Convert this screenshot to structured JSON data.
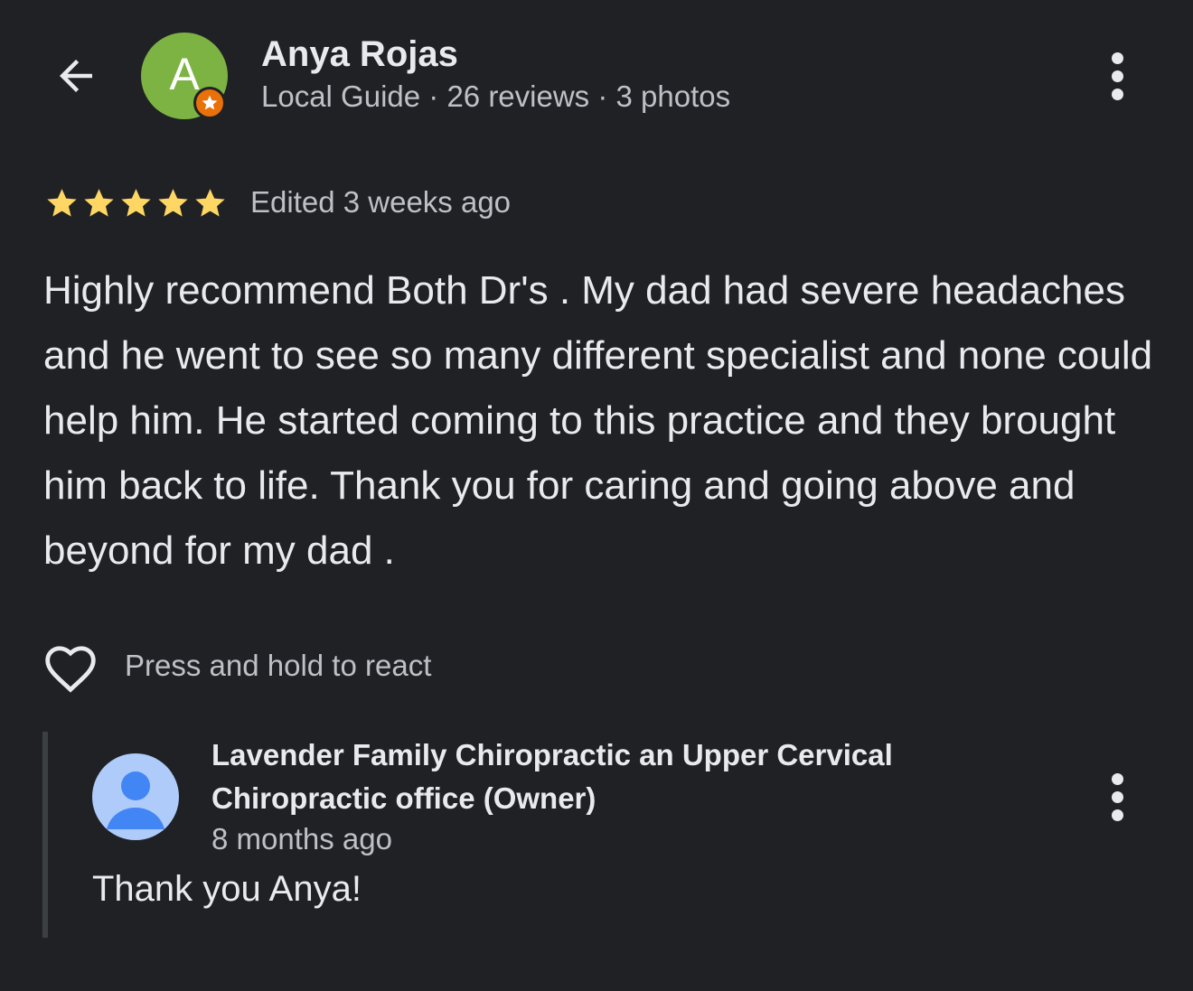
{
  "colors": {
    "background": "#202124",
    "avatar_bg": "#7cb342",
    "guide_badge": "#e8710a",
    "star": "#fdd663",
    "owner_avatar_bg": "#aecbfa",
    "owner_avatar_fg": "#4285f4",
    "reply_bar": "#3c4043"
  },
  "header": {
    "back_icon": "arrow-back-icon",
    "avatar_letter": "A",
    "name": "Anya Rojas",
    "meta": "Local Guide · 26 reviews · 3 photos",
    "more_icon": "more-vert-icon"
  },
  "review": {
    "rating": 5,
    "rating_max": 5,
    "edited": "Edited 3 weeks ago",
    "text": "Highly recommend Both Dr's . My dad had severe headaches and he went to see so many different specialist and none could help him. He started coming to this practice and they brought him back to life. Thank you for caring and going above and beyond for my dad ."
  },
  "react": {
    "icon": "heart-outline-icon",
    "label": "Press and hold to react"
  },
  "owner_reply": {
    "avatar_icon": "person-icon",
    "name": "Lavender Family Chiropractic an Upper Cervical Chiropractic office (Owner)",
    "time": "8 months ago",
    "text": "Thank you Anya!",
    "more_icon": "more-vert-icon"
  }
}
